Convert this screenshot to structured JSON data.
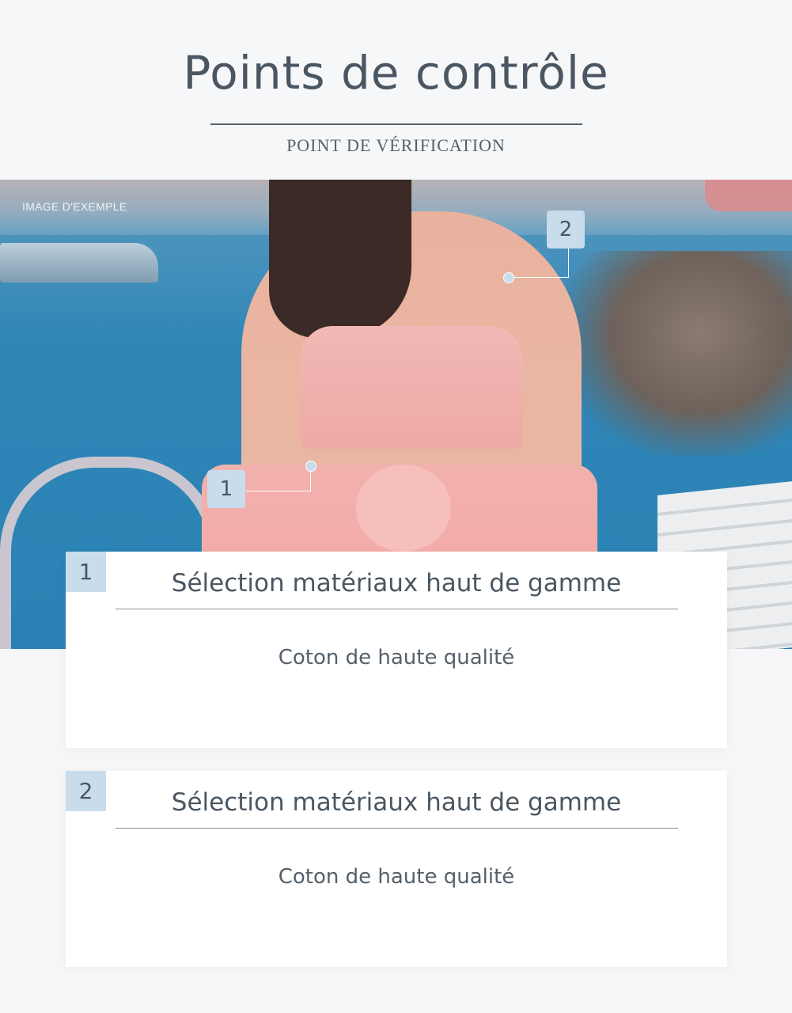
{
  "header": {
    "title": "Points de contrôle",
    "subtitle": "POINT DE VÉRIFICATION"
  },
  "photo": {
    "sample_label": "IMAGE D'EXEMPLE",
    "markers": [
      {
        "number": "1"
      },
      {
        "number": "2"
      }
    ]
  },
  "cards": [
    {
      "number": "1",
      "title": "Sélection matériaux haut de gamme",
      "description": "Coton de haute qualité"
    },
    {
      "number": "2",
      "title": "Sélection matériaux haut de gamme",
      "description": "Coton de haute qualité"
    }
  ],
  "colors": {
    "accent": "#c9dcec",
    "text": "#4a5661",
    "background": "#f6f6f8"
  }
}
